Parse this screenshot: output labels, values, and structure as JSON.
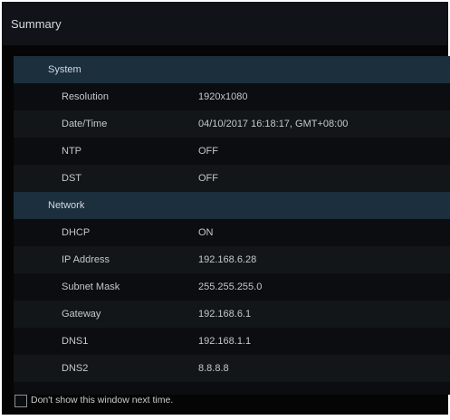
{
  "window": {
    "title": "Summary"
  },
  "sections": {
    "system": {
      "label": "System",
      "rows": [
        {
          "key": "Resolution",
          "value": "1920x1080"
        },
        {
          "key": "Date/Time",
          "value": "04/10/2017 16:18:17, GMT+08:00"
        },
        {
          "key": "NTP",
          "value": "OFF"
        },
        {
          "key": "DST",
          "value": "OFF"
        }
      ]
    },
    "network": {
      "label": "Network",
      "rows": [
        {
          "key": "DHCP",
          "value": "ON"
        },
        {
          "key": "IP Address",
          "value": "192.168.6.28"
        },
        {
          "key": "Subnet Mask",
          "value": "255.255.255.0"
        },
        {
          "key": "Gateway",
          "value": "192.168.6.1"
        },
        {
          "key": "DNS1",
          "value": "192.168.1.1"
        },
        {
          "key": "DNS2",
          "value": "8.8.8.8"
        }
      ]
    }
  },
  "footer": {
    "checkbox_label": "Don't show this window next time.",
    "checked": false
  }
}
